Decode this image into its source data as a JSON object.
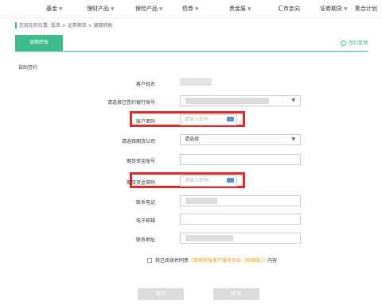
{
  "nav": {
    "items": [
      {
        "label": "基金"
      },
      {
        "label": "理财产品"
      },
      {
        "label": "保险产品"
      },
      {
        "label": "债券"
      },
      {
        "label": "贵金属"
      },
      {
        "label": "汇市走向"
      },
      {
        "label": "证券期货"
      },
      {
        "label": "集合计划"
      }
    ],
    "caret": "▼"
  },
  "breadcrumb": "您现在的位置: 投资 > 证券期货 > 银期转账",
  "tabs": {
    "active": "银期转账",
    "right_link": "签约管理"
  },
  "section_title": "自助签约",
  "form": {
    "customer_name_label": "客户姓名",
    "account_select_label": "请选择已签约银行账号",
    "account_password_label": "账户密码",
    "account_password_placeholder": "请输入密码",
    "futures_company_label": "请选择期货公司",
    "futures_company_value": "请选择",
    "futures_account_label": "期货资金账号",
    "futures_password_label": "期货资金密码",
    "futures_password_placeholder": "请输入密码",
    "phone_label": "联系电话",
    "email_label": "电子邮箱",
    "address_label": "联系地址"
  },
  "agreement": {
    "prefix": "我已阅读并同意",
    "link": "《银期转账客户服务协议（网银版）》",
    "suffix": "内容"
  },
  "buttons": {
    "submit": "提交",
    "cancel": "取消"
  },
  "colors": {
    "accent": "#3dbb8a",
    "highlight": "#e02a2a",
    "link": "#e8a317"
  }
}
